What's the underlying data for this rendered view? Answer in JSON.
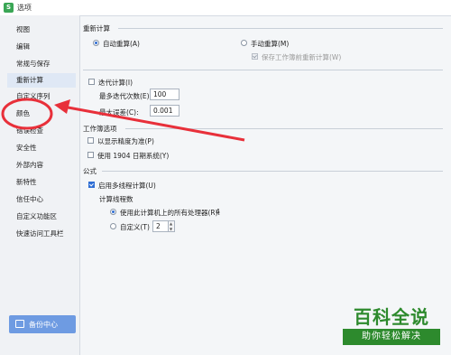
{
  "window": {
    "title": "选项",
    "app_icon_letter": "S"
  },
  "sidebar": {
    "items": [
      {
        "label": "视图"
      },
      {
        "label": "编辑"
      },
      {
        "label": "常规与保存"
      },
      {
        "label": "重新计算"
      },
      {
        "label": "自定义序列"
      },
      {
        "label": "颜色"
      },
      {
        "label": "错误检查"
      },
      {
        "label": "安全性"
      },
      {
        "label": "外部内容"
      },
      {
        "label": "新特性"
      },
      {
        "label": "信任中心"
      },
      {
        "label": "自定义功能区"
      },
      {
        "label": "快速访问工具栏"
      }
    ],
    "active_index": 3,
    "backup_button": "备份中心"
  },
  "recalc": {
    "section_title": "重新计算",
    "auto_label": "自动重算(A)",
    "manual_label": "手动重算(M)",
    "save_recalc_label": "保存工作簿前重新计算(W)",
    "iterative_label": "迭代计算(I)",
    "max_iterations_label": "最多迭代次数(E):",
    "max_iterations_value": "100",
    "max_change_label": "最大误差(C):",
    "max_change_value": "0.001"
  },
  "workbook": {
    "section_title": "工作簿选项",
    "precision_label": "以显示精度为准(P)",
    "date1904_label": "使用 1904 日期系统(Y)"
  },
  "formula": {
    "section_title": "公式",
    "multithread_label": "启用多线程计算(U)",
    "threads_title": "计算线程数",
    "use_all_label": "使用此计算机上的所有处理器(R):",
    "processor_count": "4",
    "custom_label": "自定义(T)",
    "custom_value": "2"
  },
  "watermark": {
    "title": "百科全说",
    "subtitle": "助你轻松解决"
  },
  "colors": {
    "annotation": "#e8303a",
    "accent": "#2f6ed4"
  }
}
